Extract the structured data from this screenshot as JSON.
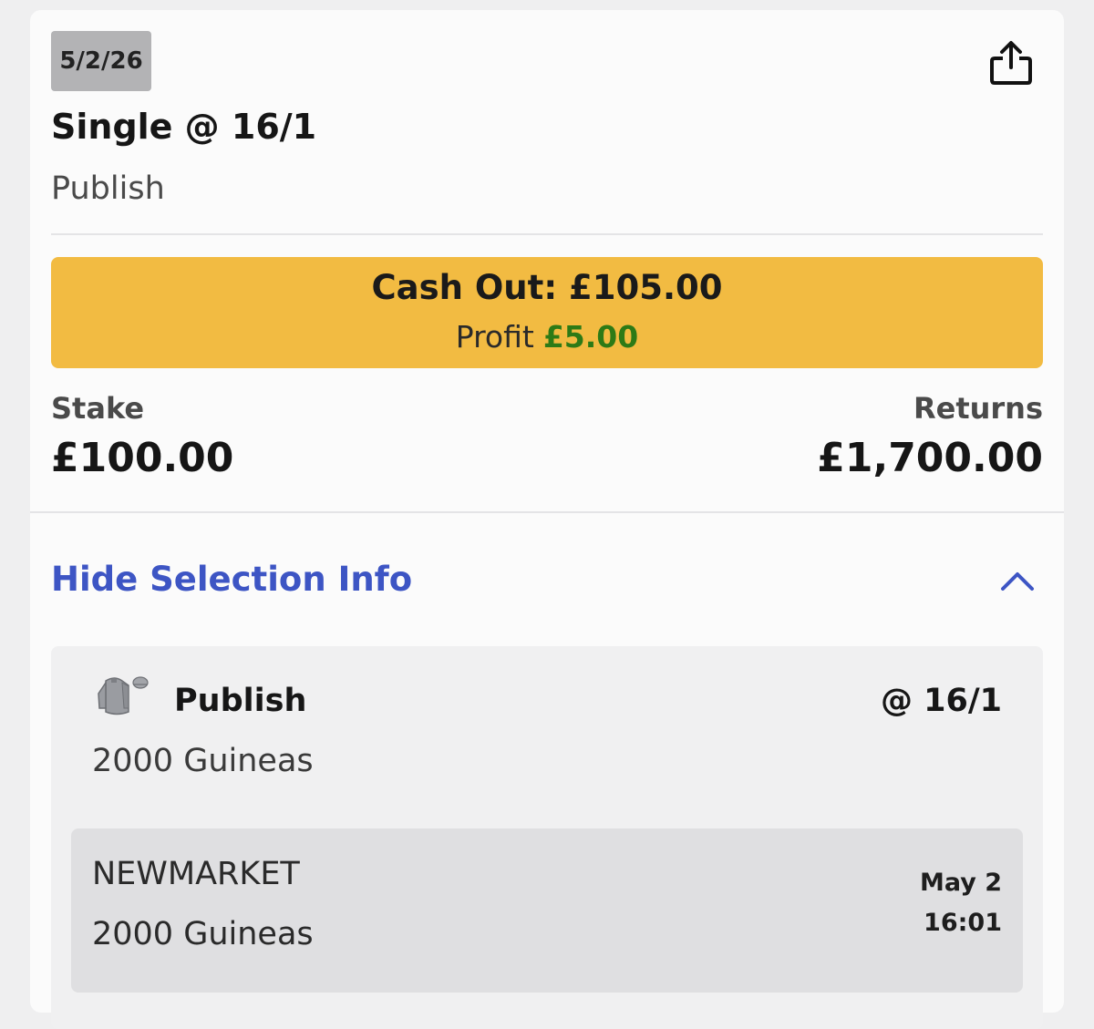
{
  "bet": {
    "date": "5/2/26",
    "title": "Single @ 16/1",
    "subtitle": "Publish",
    "share_icon": "share-icon"
  },
  "cashout": {
    "label": "Cash Out: £105.00",
    "profit_label": "Profit",
    "profit_value": "£5.00",
    "profit_color": "#2d7a16",
    "button_color": "#f2bb42"
  },
  "stake": {
    "label": "Stake",
    "value": "£100.00"
  },
  "returns": {
    "label": "Returns",
    "value": "£1,700.00"
  },
  "selection_toggle": {
    "label": "Hide Selection Info",
    "icon": "chevron-up-icon",
    "color": "#3d55c4"
  },
  "selection": {
    "silk_icon": "jockey-silk-icon",
    "runner": "Publish",
    "odds": "@ 16/1",
    "race": "2000 Guineas",
    "event": {
      "course": "NEWMARKET",
      "race": "2000 Guineas",
      "date": "May 2",
      "time": "16:01"
    }
  }
}
